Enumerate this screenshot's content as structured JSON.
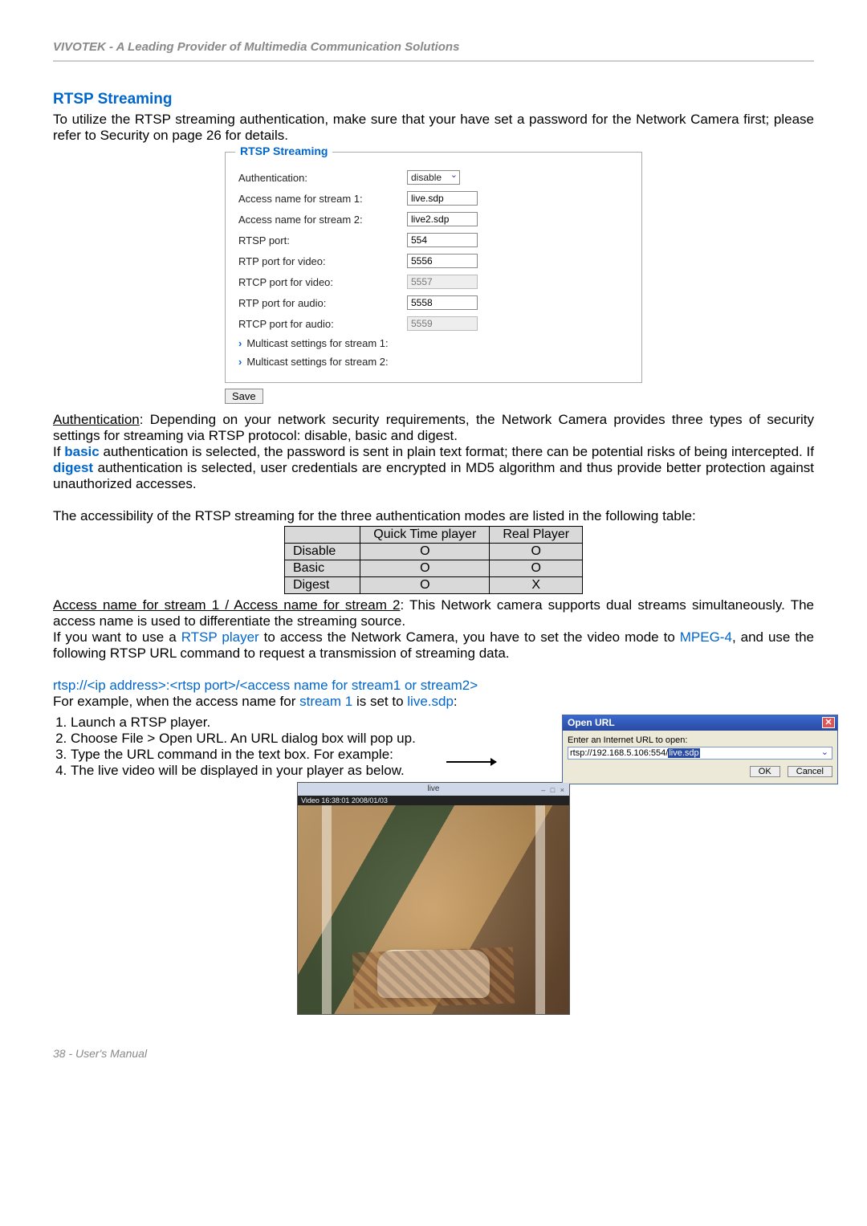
{
  "header": {
    "tagline": "VIVOTEK - A Leading Provider of Multimedia Communication Solutions"
  },
  "section": {
    "title": "RTSP Streaming",
    "intro": "To utilize the RTSP streaming authentication, make sure that your have set a password for the Network Camera first; please refer to Security on page 26 for details."
  },
  "fieldset": {
    "legend": "RTSP Streaming",
    "rows": {
      "auth_label": "Authentication:",
      "auth_value": "disable",
      "s1_label": "Access name for stream 1:",
      "s1_value": "live.sdp",
      "s2_label": "Access name for stream 2:",
      "s2_value": "live2.sdp",
      "rtsp_port_label": "RTSP port:",
      "rtsp_port_value": "554",
      "rtp_video_label": "RTP port for video:",
      "rtp_video_value": "5556",
      "rtcp_video_label": "RTCP port for video:",
      "rtcp_video_value": "5557",
      "rtp_audio_label": "RTP port for audio:",
      "rtp_audio_value": "5558",
      "rtcp_audio_label": "RTCP port for audio:",
      "rtcp_audio_value": "5559",
      "mc1": "Multicast settings for stream 1:",
      "mc2": "Multicast settings for stream 2:"
    },
    "save": "Save"
  },
  "body": {
    "auth_heading": "Authentication",
    "auth_text": ": Depending on your network security requirements, the Network Camera provides three types of security settings for streaming via RTSP protocol: disable, basic and digest.",
    "if": "If ",
    "basic": "basic",
    "basic_tail": " authentication is selected, the password is sent in plain text format; there can be potential risks of being intercepted. If ",
    "digest": "digest",
    "digest_tail": " authentication is selected, user credentials are encrypted in MD5 algorithm and thus provide better protection against unauthorized accesses.",
    "table_intro": "The accessibility of the RTSP streaming for the three authentication modes are listed in the following table:",
    "access_heading": "Access name for stream 1 / Access name for stream 2",
    "access_tail": ": This Network camera supports dual streams simultaneously. The access name is used to differentiate the streaming source.",
    "rtsp_line_a": "If you want to use a ",
    "rtsp_player": "RTSP player",
    "rtsp_line_b": " to access the Network Camera, you have to set the video mode to ",
    "mpeg4": "MPEG-4",
    "rtsp_line_c": ", and use the following RTSP URL command to request a transmission of streaming data.",
    "url_tpl": "rtsp://<ip address>:<rtsp port>/<access name for stream1 or stream2>",
    "example_a": "For example, when the access name for ",
    "stream1": "stream 1",
    "example_b": " is set to ",
    "livesdp": "live.sdp",
    "example_c": ":",
    "steps": [
      "Launch a RTSP player.",
      "Choose File > Open URL. An URL dialog box will pop up.",
      "Type the URL command in the text box. For example:",
      "The live video will be displayed in your player as below."
    ]
  },
  "chart_data": {
    "type": "table",
    "columns": [
      "",
      "Quick Time player",
      "Real Player"
    ],
    "rows": [
      [
        "Disable",
        "O",
        "O"
      ],
      [
        "Basic",
        "O",
        "O"
      ],
      [
        "Digest",
        "O",
        "X"
      ]
    ]
  },
  "dialog": {
    "title": "Open URL",
    "prompt": "Enter an Internet URL to open:",
    "url_prefix": "rtsp://192.168.5.106:554/",
    "url_hl": "live.sdp",
    "ok": "OK",
    "cancel": "Cancel"
  },
  "live": {
    "title": "live",
    "info": "Video 16:38:01 2008/01/03"
  },
  "footer": {
    "text": "38 - User's Manual"
  }
}
